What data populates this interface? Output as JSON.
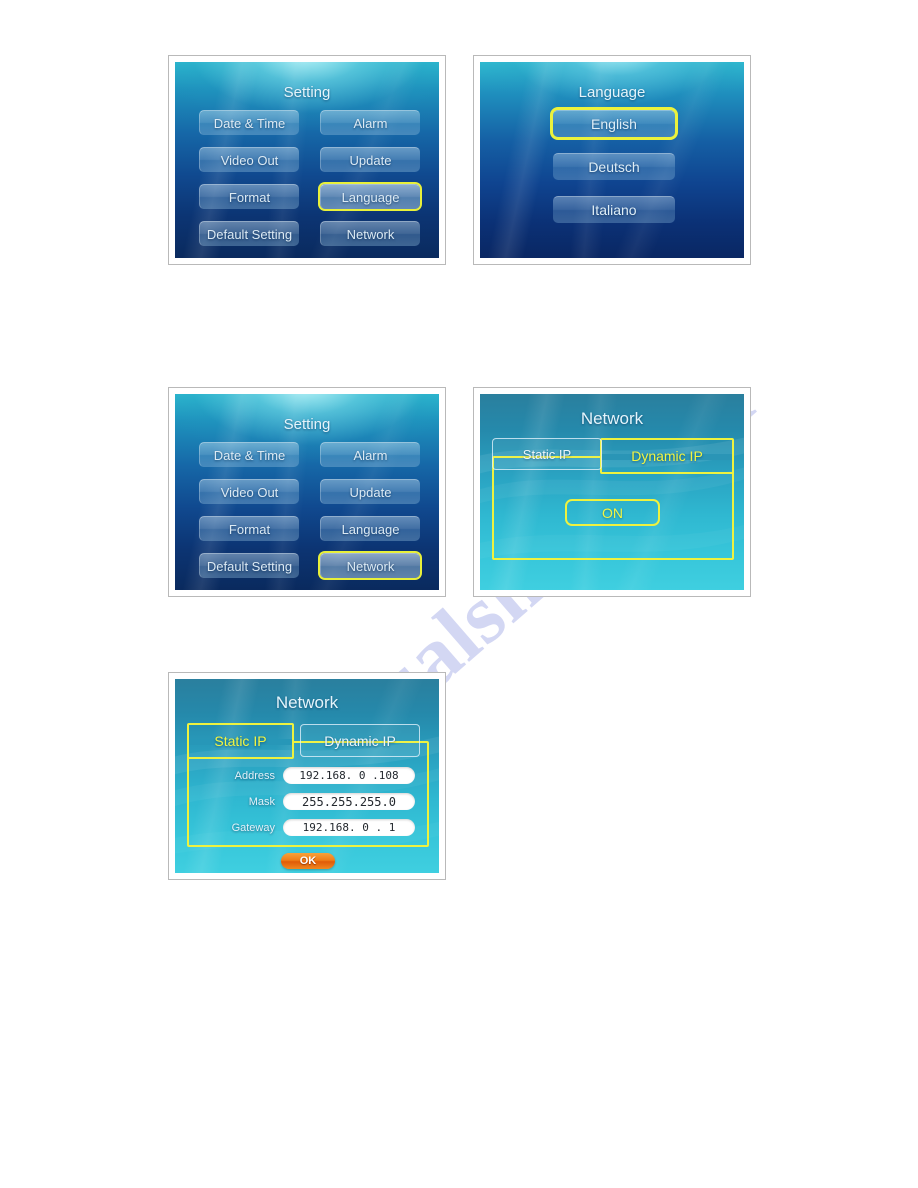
{
  "watermark": {
    "text": "manualshive.com"
  },
  "panels": {
    "setting_language": {
      "title": "Setting",
      "items": [
        {
          "label": "Date & Time",
          "selected": false
        },
        {
          "label": "Alarm",
          "selected": false
        },
        {
          "label": "Video Out",
          "selected": false
        },
        {
          "label": "Update",
          "selected": false
        },
        {
          "label": "Format",
          "selected": false
        },
        {
          "label": "Language",
          "selected": true
        },
        {
          "label": "Default Setting",
          "selected": false
        },
        {
          "label": "Network",
          "selected": false
        }
      ]
    },
    "language": {
      "title": "Language",
      "options": [
        {
          "label": "English",
          "selected": true
        },
        {
          "label": "Deutsch",
          "selected": false
        },
        {
          "label": "Italiano",
          "selected": false
        }
      ]
    },
    "setting_network": {
      "title": "Setting",
      "items": [
        {
          "label": "Date & Time",
          "selected": false
        },
        {
          "label": "Alarm",
          "selected": false
        },
        {
          "label": "Video Out",
          "selected": false
        },
        {
          "label": "Update",
          "selected": false
        },
        {
          "label": "Format",
          "selected": false
        },
        {
          "label": "Language",
          "selected": false
        },
        {
          "label": "Default Setting",
          "selected": false
        },
        {
          "label": "Network",
          "selected": true
        }
      ]
    },
    "network_dynamic": {
      "title": "Network",
      "tabs": [
        {
          "label": "Static IP",
          "active": false
        },
        {
          "label": "Dynamic IP",
          "active": true
        }
      ],
      "toggle_label": "ON"
    },
    "network_static": {
      "title": "Network",
      "tabs": [
        {
          "label": "Static IP",
          "active": true
        },
        {
          "label": "Dynamic IP",
          "active": false
        }
      ],
      "fields": [
        {
          "label": "Address",
          "value": "192.168. 0 .108"
        },
        {
          "label": "Mask",
          "value": "255.255.255.0"
        },
        {
          "label": "Gateway",
          "value": "192.168. 0 . 1"
        }
      ],
      "ok_label": "OK"
    }
  },
  "colors": {
    "highlight_yellow": "#eef23f",
    "ok_orange": "#ef7e18",
    "screen_text": "#dceaf4"
  }
}
